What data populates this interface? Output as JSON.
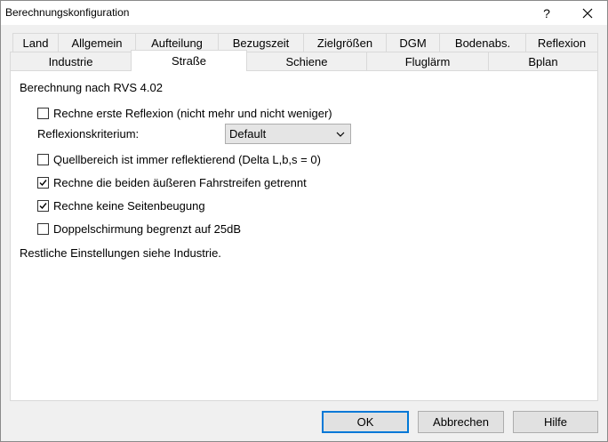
{
  "window": {
    "title": "Berechnungskonfiguration",
    "help_glyph": "?"
  },
  "tabs_row1": [
    "Land",
    "Allgemein",
    "Aufteilung",
    "Bezugszeit",
    "Zielgrößen",
    "DGM",
    "Bodenabs.",
    "Reflexion"
  ],
  "tabs_row2": [
    "Industrie",
    "Straße",
    "Schiene",
    "Fluglärm",
    "Bplan"
  ],
  "active_tab": "Straße",
  "panel": {
    "heading": "Berechnung nach RVS 4.02",
    "options": [
      {
        "label": "Rechne erste Reflexion (nicht mehr und nicht weniger)",
        "checked": false
      },
      {
        "label": "Quellbereich ist immer reflektierend (Delta L,b,s = 0)",
        "checked": false
      },
      {
        "label": "Rechne die beiden äußeren Fahrstreifen getrennt",
        "checked": true
      },
      {
        "label": "Rechne keine Seitenbeugung",
        "checked": true
      },
      {
        "label": "Doppelschirmung begrenzt auf 25dB",
        "checked": false
      }
    ],
    "reflexion_label": "Reflexionskriterium:",
    "reflexion_value": "Default",
    "footer_note": "Restliche Einstellungen siehe Industrie."
  },
  "buttons": {
    "ok": "OK",
    "cancel": "Abbrechen",
    "help": "Hilfe"
  },
  "colors": {
    "default_button_border": "#0078d7",
    "panel_bg": "#ffffff",
    "window_bg": "#f0f0f0"
  },
  "icons": {
    "close": "close-icon",
    "chevron": "chevron-down-icon",
    "check": "checkmark-icon"
  }
}
